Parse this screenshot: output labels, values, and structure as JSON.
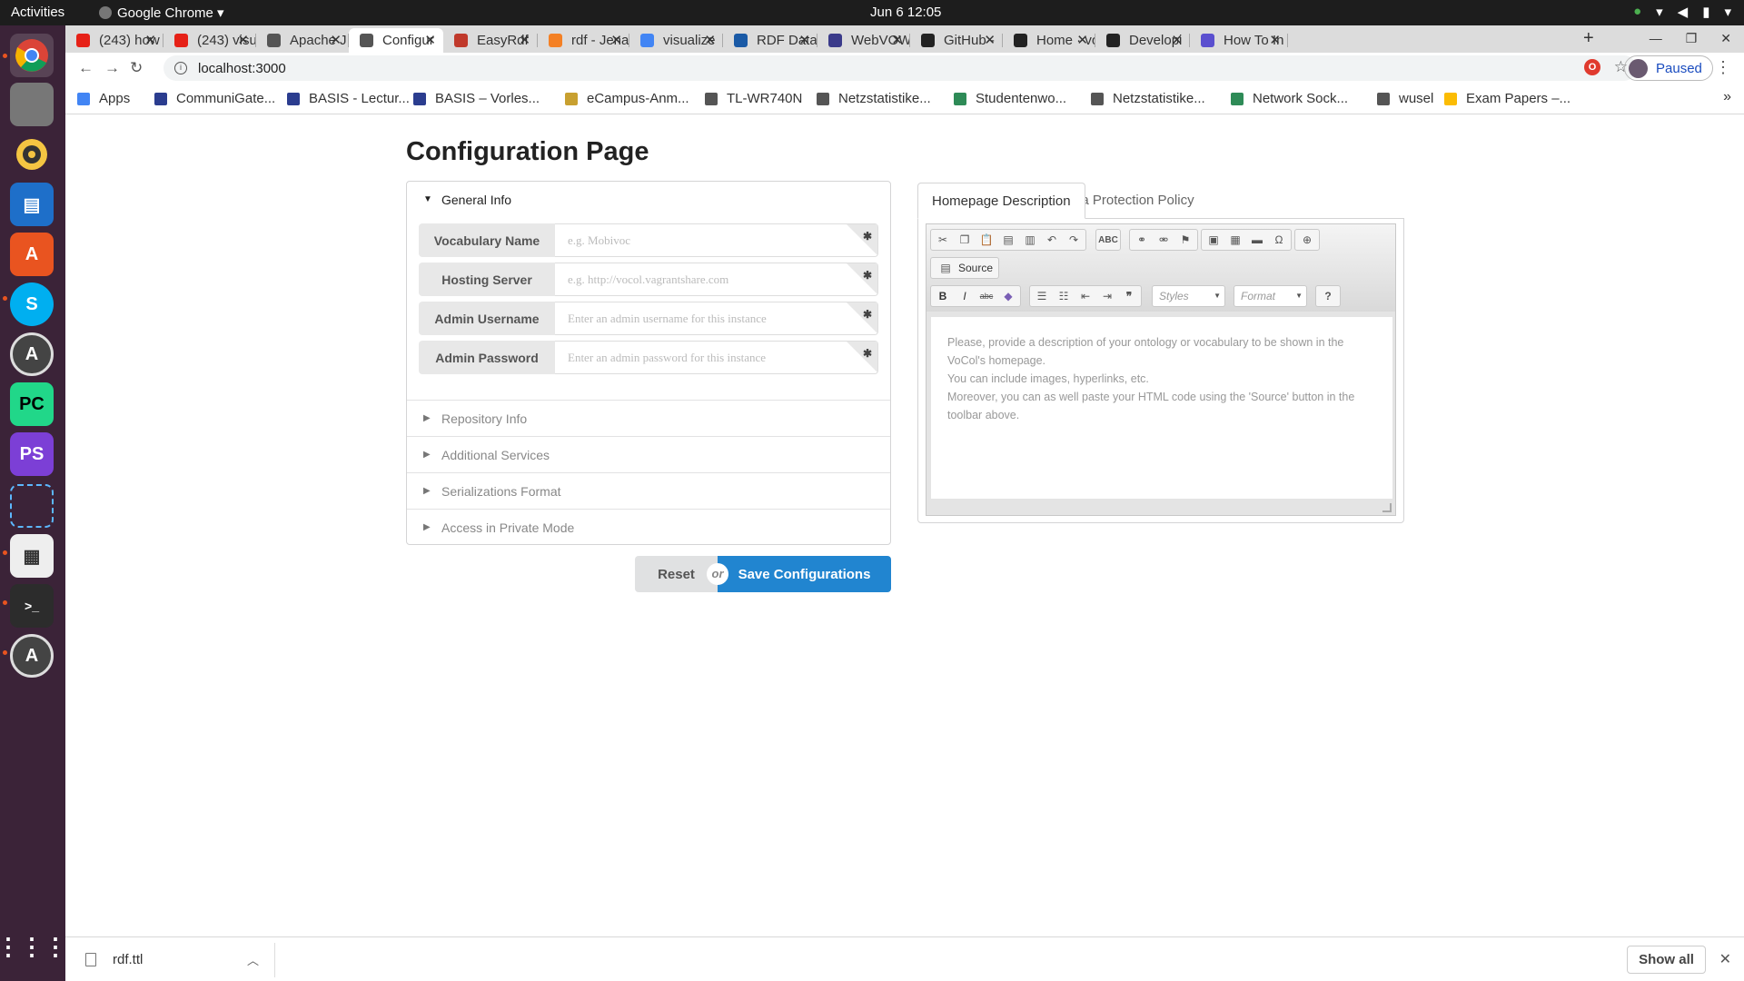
{
  "system": {
    "activities": "Activities",
    "app_name": "Google Chrome ▾",
    "clock": "Jun 6  12:05"
  },
  "browser": {
    "tabs": [
      {
        "label": "(243) how",
        "icon": "youtube-icon",
        "color": "#e62117"
      },
      {
        "label": "(243) visu",
        "icon": "youtube-icon",
        "color": "#e62117"
      },
      {
        "label": "Apache J",
        "icon": "globe-icon",
        "color": "#555555"
      },
      {
        "label": "Configur",
        "icon": "globe-icon",
        "color": "#555555",
        "active": true
      },
      {
        "label": "EasyRdf",
        "icon": "easyrdf-icon",
        "color": "#c0392b"
      },
      {
        "label": "rdf - Jena",
        "icon": "stackoverflow-icon",
        "color": "#f48024"
      },
      {
        "label": "visualize",
        "icon": "google-icon",
        "color": "#4285f4"
      },
      {
        "label": "RDF Data",
        "icon": "w3c-icon",
        "color": "#1a5aa6"
      },
      {
        "label": "WebVOW",
        "icon": "webvowl-icon",
        "color": "#3a3a8a"
      },
      {
        "label": "GitHub -",
        "icon": "github-icon",
        "color": "#222222"
      },
      {
        "label": "Home · vo",
        "icon": "github-icon",
        "color": "#222222"
      },
      {
        "label": "Developi",
        "icon": "github-icon",
        "color": "#222222"
      },
      {
        "label": "How To In",
        "icon": "link-icon",
        "color": "#5a4fcf"
      }
    ],
    "url": "localhost:3000",
    "profile_label": "Paused",
    "bookmarks": [
      {
        "label": "Apps",
        "icon": "apps-grid-icon",
        "color": "#4285f4"
      },
      {
        "label": "CommuniGate...",
        "icon": "folder-icon",
        "color": "#2b3d8f"
      },
      {
        "label": "BASIS - Lectur...",
        "icon": "folder-icon",
        "color": "#2b3d8f"
      },
      {
        "label": "BASIS – Vorles...",
        "icon": "folder-icon",
        "color": "#2b3d8f"
      },
      {
        "label": "eCampus-Anm...",
        "icon": "ecampus-icon",
        "color": "#c8a030"
      },
      {
        "label": "TL-WR740N",
        "icon": "globe-icon",
        "color": "#555555"
      },
      {
        "label": "Netzstatistike...",
        "icon": "globe-icon",
        "color": "#555555"
      },
      {
        "label": "Studentenwo...",
        "icon": "checklist-icon",
        "color": "#2e8b57"
      },
      {
        "label": "Netzstatistike...",
        "icon": "globe-icon",
        "color": "#555555"
      },
      {
        "label": "Network Sock...",
        "icon": "checklist-icon",
        "color": "#2e8b57"
      },
      {
        "label": "wusel",
        "icon": "globe-icon",
        "color": "#555555"
      },
      {
        "label": "Exam Papers –...",
        "icon": "drive-icon",
        "color": "#fbbc04"
      }
    ]
  },
  "page": {
    "title": "Configuration Page",
    "general_info": "General Info",
    "fields": [
      {
        "label": "Vocabulary Name",
        "placeholder": "e.g. Mobivoc"
      },
      {
        "label": "Hosting Server",
        "placeholder": "e.g. http://vocol.vagrantshare.com"
      },
      {
        "label": "Admin Username",
        "placeholder": "Enter an admin username for this instance"
      },
      {
        "label": "Admin Password",
        "placeholder": "Enter an admin password for this instance"
      }
    ],
    "sections": [
      "Repository Info",
      "Additional Services",
      "Serializations Format",
      "Access in Private Mode"
    ],
    "reset_label": "Reset",
    "or_label": "or",
    "save_label": "Save Configurations",
    "right_tabs": [
      "Homepage Description",
      "Data Protection Policy"
    ],
    "editor": {
      "source_label": "Source",
      "styles_label": "Styles",
      "format_label": "Format",
      "placeholder_lines": [
        "Please, provide a description of your ontology or vocabulary to be shown in the",
        "VoCol's homepage.",
        "You can include images, hyperlinks, etc.",
        "Moreover, you can as well paste your HTML code using the 'Source' button in the",
        "toolbar above."
      ]
    }
  },
  "downloads": {
    "file": "rdf.ttl",
    "show_all": "Show all"
  }
}
